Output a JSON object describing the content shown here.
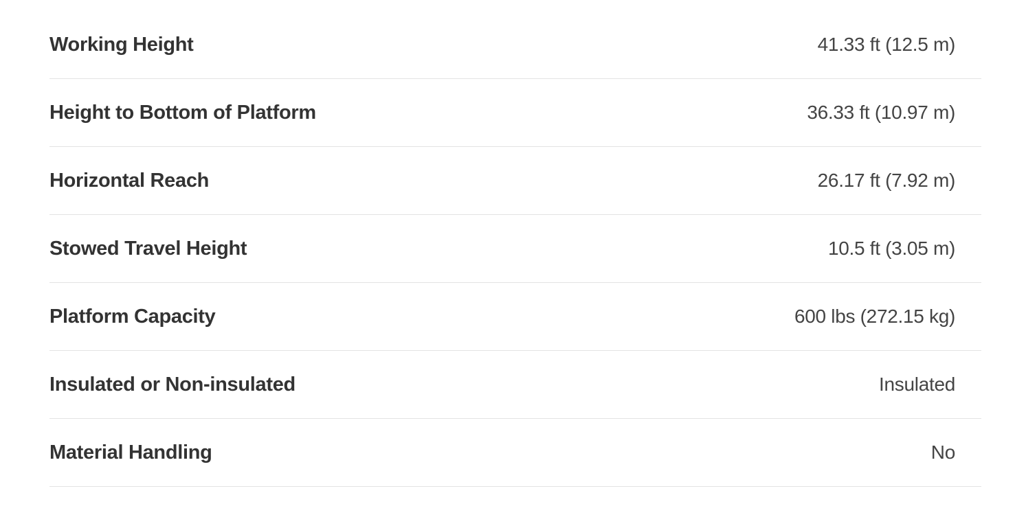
{
  "specs": {
    "rows": [
      {
        "label": "Working Height",
        "value": "41.33 ft (12.5 m)"
      },
      {
        "label": "Height to Bottom of Platform",
        "value": "36.33 ft (10.97 m)"
      },
      {
        "label": "Horizontal Reach",
        "value": "26.17 ft (7.92 m)"
      },
      {
        "label": "Stowed Travel Height",
        "value": "10.5 ft (3.05 m)"
      },
      {
        "label": "Platform Capacity",
        "value": "600 lbs (272.15 kg)"
      },
      {
        "label": "Insulated or Non-insulated",
        "value": "Insulated"
      },
      {
        "label": "Material Handling",
        "value": "No"
      }
    ]
  },
  "colors": {
    "label_text": "#333333",
    "value_text": "#444444",
    "divider": "#e3e3e3",
    "background": "#ffffff"
  }
}
